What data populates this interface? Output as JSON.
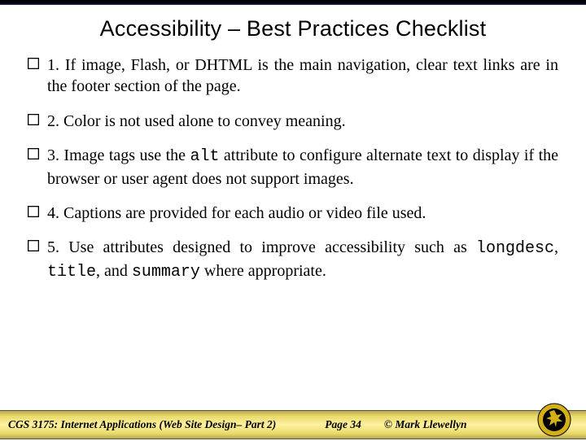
{
  "title": "Accessibility – Best Practices Checklist",
  "items": [
    {
      "html": "1. If image, Flash, or DHTML is the main navigation, clear text links are in the footer section of the page."
    },
    {
      "html": "2. Color is not used alone to convey meaning."
    },
    {
      "html": "3. Image tags use the <span class=\"code\">alt</span> attribute to configure alternate text to display if the browser or user agent does not support images."
    },
    {
      "html": "4. Captions are provided for each audio or video file used."
    },
    {
      "html": "5. Use attributes designed to improve accessibility such as <span class=\"code\">longdesc</span>, <span class=\"code\">title</span>, and <span class=\"code\">summary</span> where appropriate."
    }
  ],
  "footer": {
    "course": "CGS 3175: Internet Applications (Web Site Design– Part 2)",
    "page": "Page 34",
    "copyright": "© Mark Llewellyn"
  }
}
